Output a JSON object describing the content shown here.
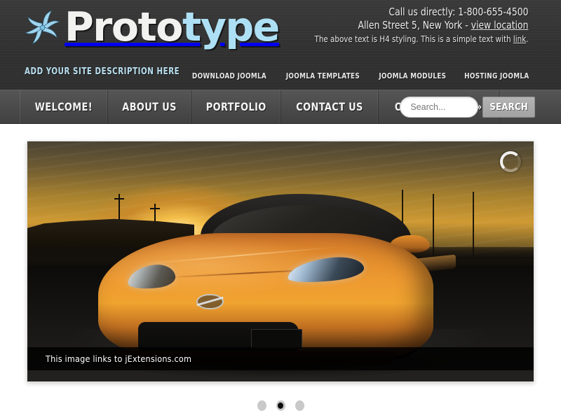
{
  "site": {
    "logo_primary": "Proto",
    "logo_secondary": "type",
    "description": "Add your site description here"
  },
  "header": {
    "contact_line1": "Call us directly: 1-800-655-4500",
    "contact_line2_prefix": "Allen Street 5, New York - ",
    "contact_line2_link": "view location",
    "contact_note_prefix": "The above text is H4 styling. This is a simple text with ",
    "contact_note_link": "link",
    "contact_note_suffix": ".",
    "top_links": [
      {
        "label": "Download Joomla"
      },
      {
        "label": "Joomla Templates"
      },
      {
        "label": "Joomla Modules"
      },
      {
        "label": "Hosting Joomla"
      }
    ]
  },
  "menu": {
    "items": [
      {
        "label": "Welcome!"
      },
      {
        "label": "About Us"
      },
      {
        "label": "Portfolio"
      },
      {
        "label": "Contact Us"
      },
      {
        "label": "Our Services »"
      }
    ]
  },
  "search": {
    "placeholder": "Search...",
    "value": "",
    "button_label": "Search"
  },
  "slider": {
    "caption": "This image links to jExtensions.com",
    "spinner_icon": "loading-spinner-icon",
    "slides_total": 3,
    "active_slide": 2,
    "image_alt": "Orange Nissan 350Z sports car photographed at sunset"
  },
  "colors": {
    "header_bg": "#333333",
    "menu_bg": "#4c4c4c",
    "accent_blue": "#ade0f4",
    "page_bg": "#ffffff",
    "car_orange": "#f0a32f"
  }
}
